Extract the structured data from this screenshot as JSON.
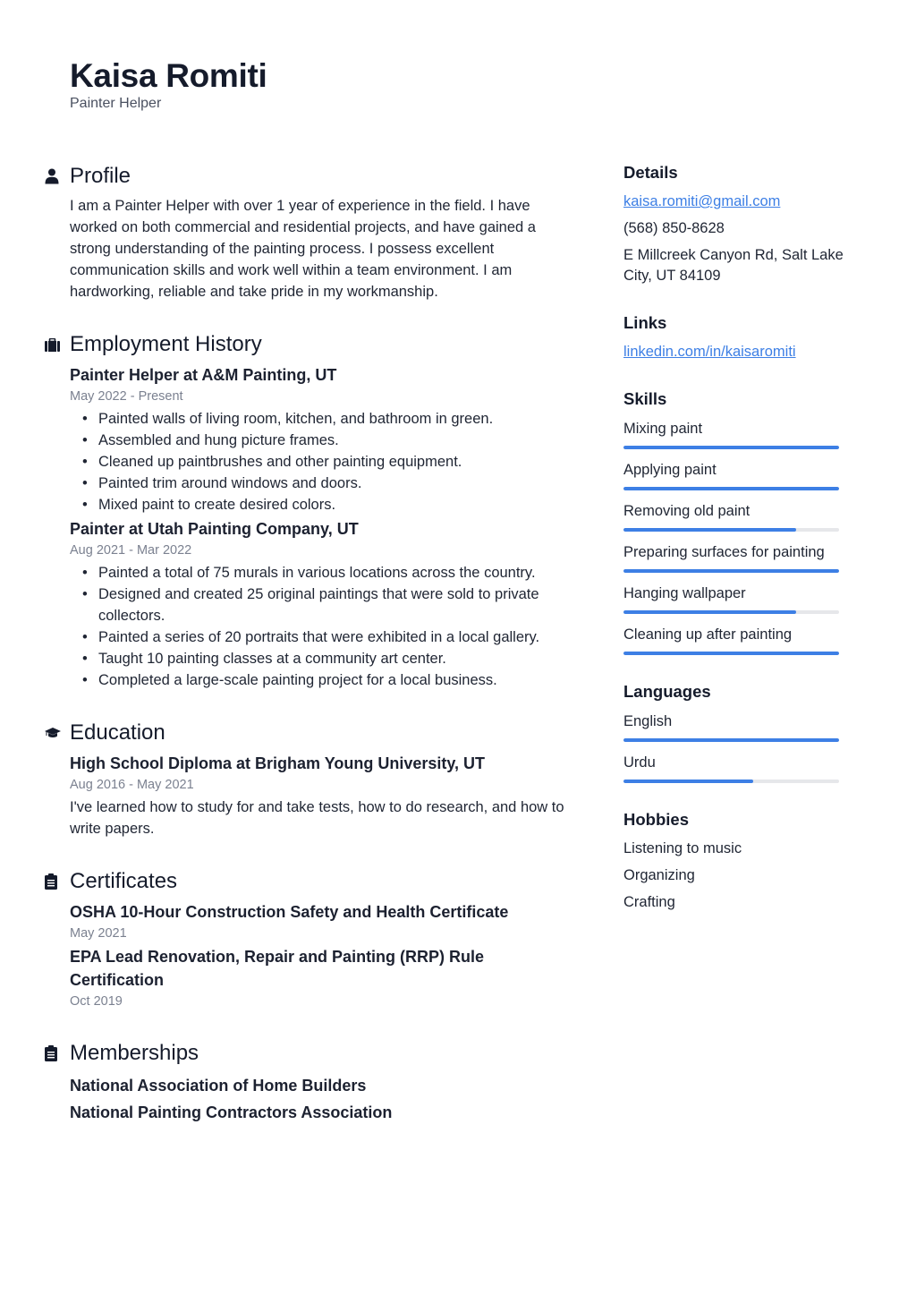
{
  "header": {
    "name": "Kaisa Romiti",
    "title": "Painter Helper"
  },
  "profile": {
    "heading": "Profile",
    "icon": "person-icon",
    "text": "I am a Painter Helper with over 1 year of experience in the field. I have worked on both commercial and residential projects, and have gained a strong understanding of the painting process. I possess excellent communication skills and work well within a team environment. I am hardworking, reliable and take pride in my workmanship."
  },
  "employment": {
    "heading": "Employment History",
    "icon": "briefcase-icon",
    "jobs": [
      {
        "title": "Painter Helper at A&M Painting, UT",
        "dates": "May 2022 - Present",
        "bullets": [
          "Painted walls of living room, kitchen, and bathroom in green.",
          "Assembled and hung picture frames.",
          "Cleaned up paintbrushes and other painting equipment.",
          "Painted trim around windows and doors.",
          "Mixed paint to create desired colors."
        ]
      },
      {
        "title": "Painter at Utah Painting Company, UT",
        "dates": "Aug 2021 - Mar 2022",
        "bullets": [
          "Painted a total of 75 murals in various locations across the country.",
          "Designed and created 25 original paintings that were sold to private collectors.",
          "Painted a series of 20 portraits that were exhibited in a local gallery.",
          "Taught 10 painting classes at a community art center.",
          "Completed a large-scale painting project for a local business."
        ]
      }
    ]
  },
  "education": {
    "heading": "Education",
    "icon": "graduation-cap-icon",
    "items": [
      {
        "title": "High School Diploma at Brigham Young University, UT",
        "dates": "Aug 2016 - May 2021",
        "description": "I've learned how to study for and take tests, how to do research, and how to write papers."
      }
    ]
  },
  "certificates": {
    "heading": "Certificates",
    "icon": "clipboard-icon",
    "items": [
      {
        "title": "OSHA 10-Hour Construction Safety and Health Certificate",
        "date": "May 2021"
      },
      {
        "title": "EPA Lead Renovation, Repair and Painting (RRP) Rule Certification",
        "date": "Oct 2019"
      }
    ]
  },
  "memberships": {
    "heading": "Memberships",
    "icon": "clipboard-icon",
    "items": [
      "National Association of Home Builders",
      "National Painting Contractors Association"
    ]
  },
  "details": {
    "heading": "Details",
    "email": "kaisa.romiti@gmail.com",
    "phone": "(568) 850-8628",
    "address": "E Millcreek Canyon Rd, Salt Lake City, UT 84109"
  },
  "links": {
    "heading": "Links",
    "items": [
      "linkedin.com/in/kaisaromiti"
    ]
  },
  "skills": {
    "heading": "Skills",
    "items": [
      {
        "label": "Mixing paint",
        "level": 100
      },
      {
        "label": "Applying paint",
        "level": 100
      },
      {
        "label": "Removing old paint",
        "level": 80
      },
      {
        "label": "Preparing surfaces for painting",
        "level": 100
      },
      {
        "label": "Hanging wallpaper",
        "level": 80
      },
      {
        "label": "Cleaning up after painting",
        "level": 100
      }
    ]
  },
  "languages": {
    "heading": "Languages",
    "items": [
      {
        "label": "English",
        "level": 100
      },
      {
        "label": "Urdu",
        "level": 60
      }
    ]
  },
  "hobbies": {
    "heading": "Hobbies",
    "items": [
      "Listening to music",
      "Organizing",
      "Crafting"
    ]
  },
  "colors": {
    "accent": "#3d7fe5",
    "text": "#1c2130",
    "muted": "#7b8190",
    "track": "#e6e7ea"
  }
}
